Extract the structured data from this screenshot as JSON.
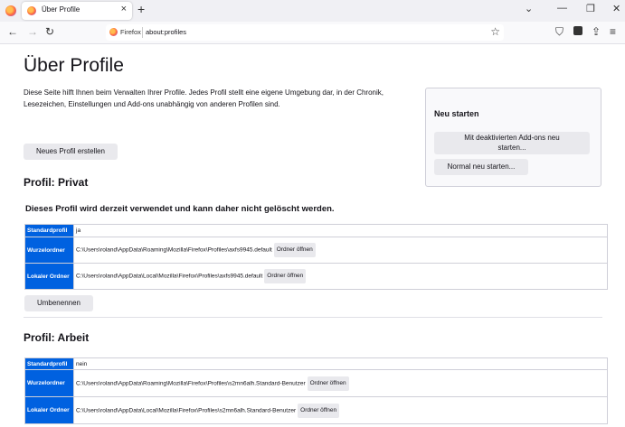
{
  "browser": {
    "tab_title": "Über Profile",
    "tab_close": "×",
    "new_tab": "+",
    "url_identity": "Firefox",
    "url": "about:profiles",
    "window_controls": [
      "⌄",
      "—",
      "❐",
      "✕"
    ]
  },
  "page": {
    "title": "Über Profile",
    "intro": "Diese Seite hilft Ihnen beim Verwalten Ihrer Profile. Jedes Profil stellt eine eigene Umgebung dar, in der Chronik, Lesezeichen, Einstellungen und Add-ons unabhängig von anderen Profilen sind.",
    "new_profile_button": "Neues Profil erstellen",
    "restart": {
      "title": "Neu starten",
      "addons_disabled_button_line1": "Mit deaktivierten Add-ons neu",
      "addons_disabled_button_line2": "starten...",
      "normal_button": "Normal neu starten..."
    }
  },
  "profiles": [
    {
      "heading": "Profil: Privat",
      "notice": "Dieses Profil wird derzeit verwendet und kann daher nicht gelöscht werden.",
      "rows": [
        {
          "key": "Standardprofil",
          "value": "ja"
        },
        {
          "key": "Wurzelordner",
          "value": "C:\\Users\\roland\\AppData\\Roaming\\Mozilla\\Firefox\\Profiles\\axfs9945.default",
          "button": "Ordner öffnen"
        },
        {
          "key": "Lokaler Ordner",
          "value": "C:\\Users\\roland\\AppData\\Local\\Mozilla\\Firefox\\Profiles\\axfs9945.default",
          "button": "Ordner öffnen"
        }
      ],
      "rename_button": "Umbenennen"
    },
    {
      "heading": "Profil: Arbeit",
      "rows": [
        {
          "key": "Standardprofil",
          "value": "nein"
        },
        {
          "key": "Wurzelordner",
          "value": "C:\\Users\\roland\\AppData\\Roaming\\Mozilla\\Firefox\\Profiles\\s2mn6alh.Standard-Benutzer",
          "button": "Ordner öffnen"
        },
        {
          "key": "Lokaler Ordner",
          "value": "C:\\Users\\roland\\AppData\\Local\\Mozilla\\Firefox\\Profiles\\s2mn6alh.Standard-Benutzer",
          "button": "Ordner öffnen"
        }
      ]
    }
  ]
}
